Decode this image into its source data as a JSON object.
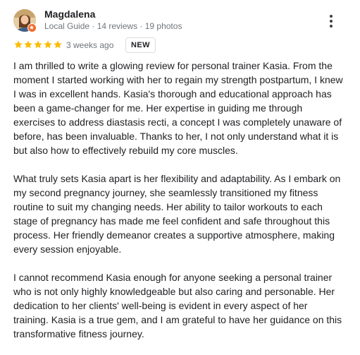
{
  "author": {
    "name": "Magdalena",
    "meta": "Local Guide · 14 reviews · 19 photos",
    "avatar_icon": "user-avatar-photo",
    "badge_icon": "local-guide-badge-icon"
  },
  "rating": {
    "stars": 5,
    "max_stars": 5,
    "star_color": "#fbbc04",
    "date": "3 weeks ago",
    "badge": "NEW"
  },
  "more_menu_icon": "more-vert-icon",
  "review": {
    "paragraphs": [
      "I am thrilled to write a glowing review for personal trainer Kasia. From the moment I started working with her to regain my strength postpartum, I knew I was in excellent hands. Kasia's thorough and educational approach has been a game-changer for me. Her expertise in guiding me through exercises to address diastasis recti, a concept I was completely unaware of before, has been invaluable. Thanks to her, I not only understand what it is but also how to effectively rebuild my core muscles.",
      "What truly sets Kasia apart is her flexibility and adaptability. As I embark on my second pregnancy journey, she seamlessly transitioned my fitness routine to suit my changing needs. Her ability to tailor workouts to each stage of pregnancy has made me feel confident and safe throughout this process. Her friendly demeanor creates a supportive atmosphere, making every session enjoyable.",
      "I cannot recommend Kasia enough for anyone seeking a personal trainer who is not only highly knowledgeable but also caring and personable. Her dedication to her clients' well-being is evident in every aspect of her training. Kasia is a true gem, and I am grateful to have her guidance on this transformative fitness journey."
    ]
  }
}
